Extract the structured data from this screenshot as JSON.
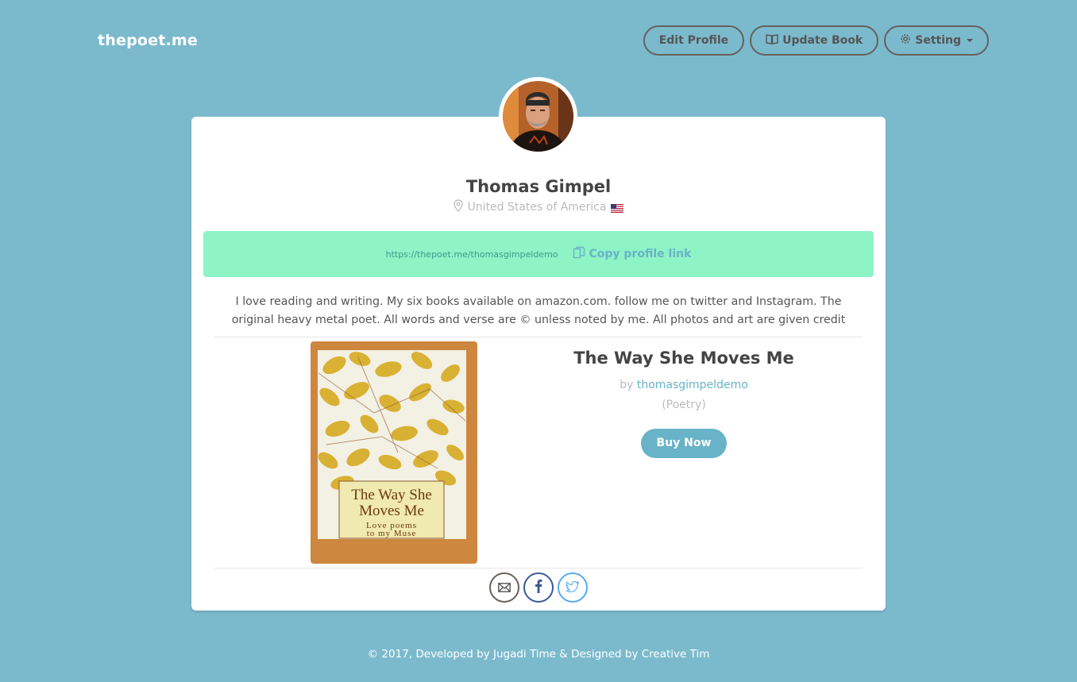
{
  "brand": "thepoet.me",
  "nav": {
    "edit_profile": "Edit Profile",
    "update_book": "Update Book",
    "setting": "Setting"
  },
  "profile": {
    "name": "Thomas Gimpel",
    "location": "United States of America",
    "profile_url": "https://thepoet.me/thomasgimpeldemo",
    "copy_link_label": "Copy profile link",
    "bio": "I love reading and writing. My six books available on amazon.com. follow me on twitter and Instagram. The original heavy metal poet. All words and verse are © unless noted by me. All photos and art are given credit"
  },
  "book": {
    "title": "The Way She Moves Me",
    "by_prefix": "by",
    "author": "thomasgimpeldemo",
    "genre": "(Poetry)",
    "buy_label": "Buy Now",
    "cover_title_line1": "The Way She",
    "cover_title_line2": "Moves Me",
    "cover_subtitle_line1": "Love poems",
    "cover_subtitle_line2": "to my Muse"
  },
  "socials": [
    "mail-icon",
    "facebook-icon",
    "twitter-icon"
  ],
  "footer": "© 2017, Developed by Jugadi Time & Designed by Creative Tim",
  "colors": {
    "background": "#7bbacd",
    "accent": "#68b3c8",
    "link_box": "#8ef3c5"
  }
}
